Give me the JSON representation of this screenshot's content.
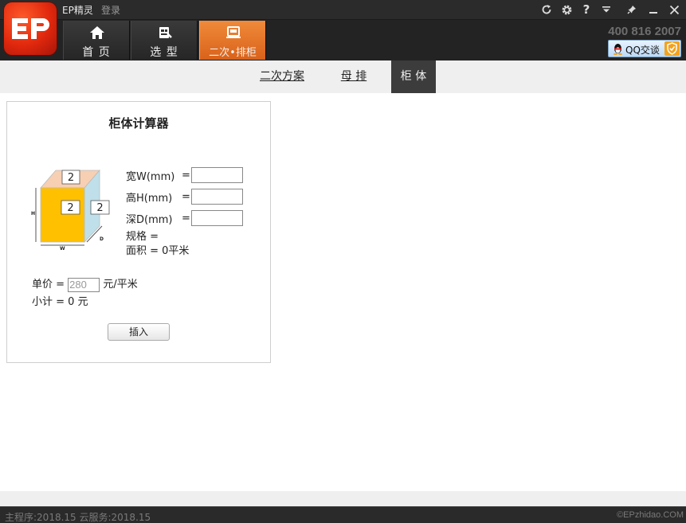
{
  "app": {
    "name": "EP精灵",
    "login_link": "登录",
    "logo_text": "EP"
  },
  "nav": {
    "tabs": [
      {
        "label": "首 页",
        "icon": "home-icon"
      },
      {
        "label": "选 型",
        "icon": "selection-icon"
      },
      {
        "label": "二次•排柜",
        "icon": "cabinet-icon",
        "active": true
      }
    ]
  },
  "header": {
    "phone": "400 816 2007",
    "qq_label": "QQ交谈"
  },
  "subnav": {
    "tabs": [
      {
        "label": "二次方案"
      },
      {
        "label": "母 排"
      },
      {
        "label": "柜 体",
        "active": true
      }
    ]
  },
  "calculator": {
    "title": "柜体计算器",
    "diagram": {
      "top_value": "2",
      "front_value": "2",
      "side_value": "2",
      "label_h": "H",
      "label_w": "W",
      "label_d": "D"
    },
    "fields": [
      {
        "label": "宽W(mm)",
        "eq": "=",
        "value": ""
      },
      {
        "label": "高H(mm)",
        "eq": "=",
        "value": ""
      },
      {
        "label": "深D(mm)",
        "eq": "=",
        "value": ""
      }
    ],
    "spec_line": "规格 =",
    "area_line": "面积 = 0平米",
    "unit_price_prefix": "单价 =",
    "unit_price_value": "280",
    "unit_price_suffix": "元/平米",
    "subtotal_line": "小计 = 0 元",
    "insert_label": "插入"
  },
  "status": {
    "left": "主程序:2018.15  云服务:2018.15",
    "right": "©EPzhidao.COM"
  },
  "colors": {
    "accent": "#e8752a",
    "dark": "#232323",
    "cabinet_front": "#ffc000",
    "cabinet_top": "#f7cfb2",
    "cabinet_side": "#bfe0ea"
  }
}
